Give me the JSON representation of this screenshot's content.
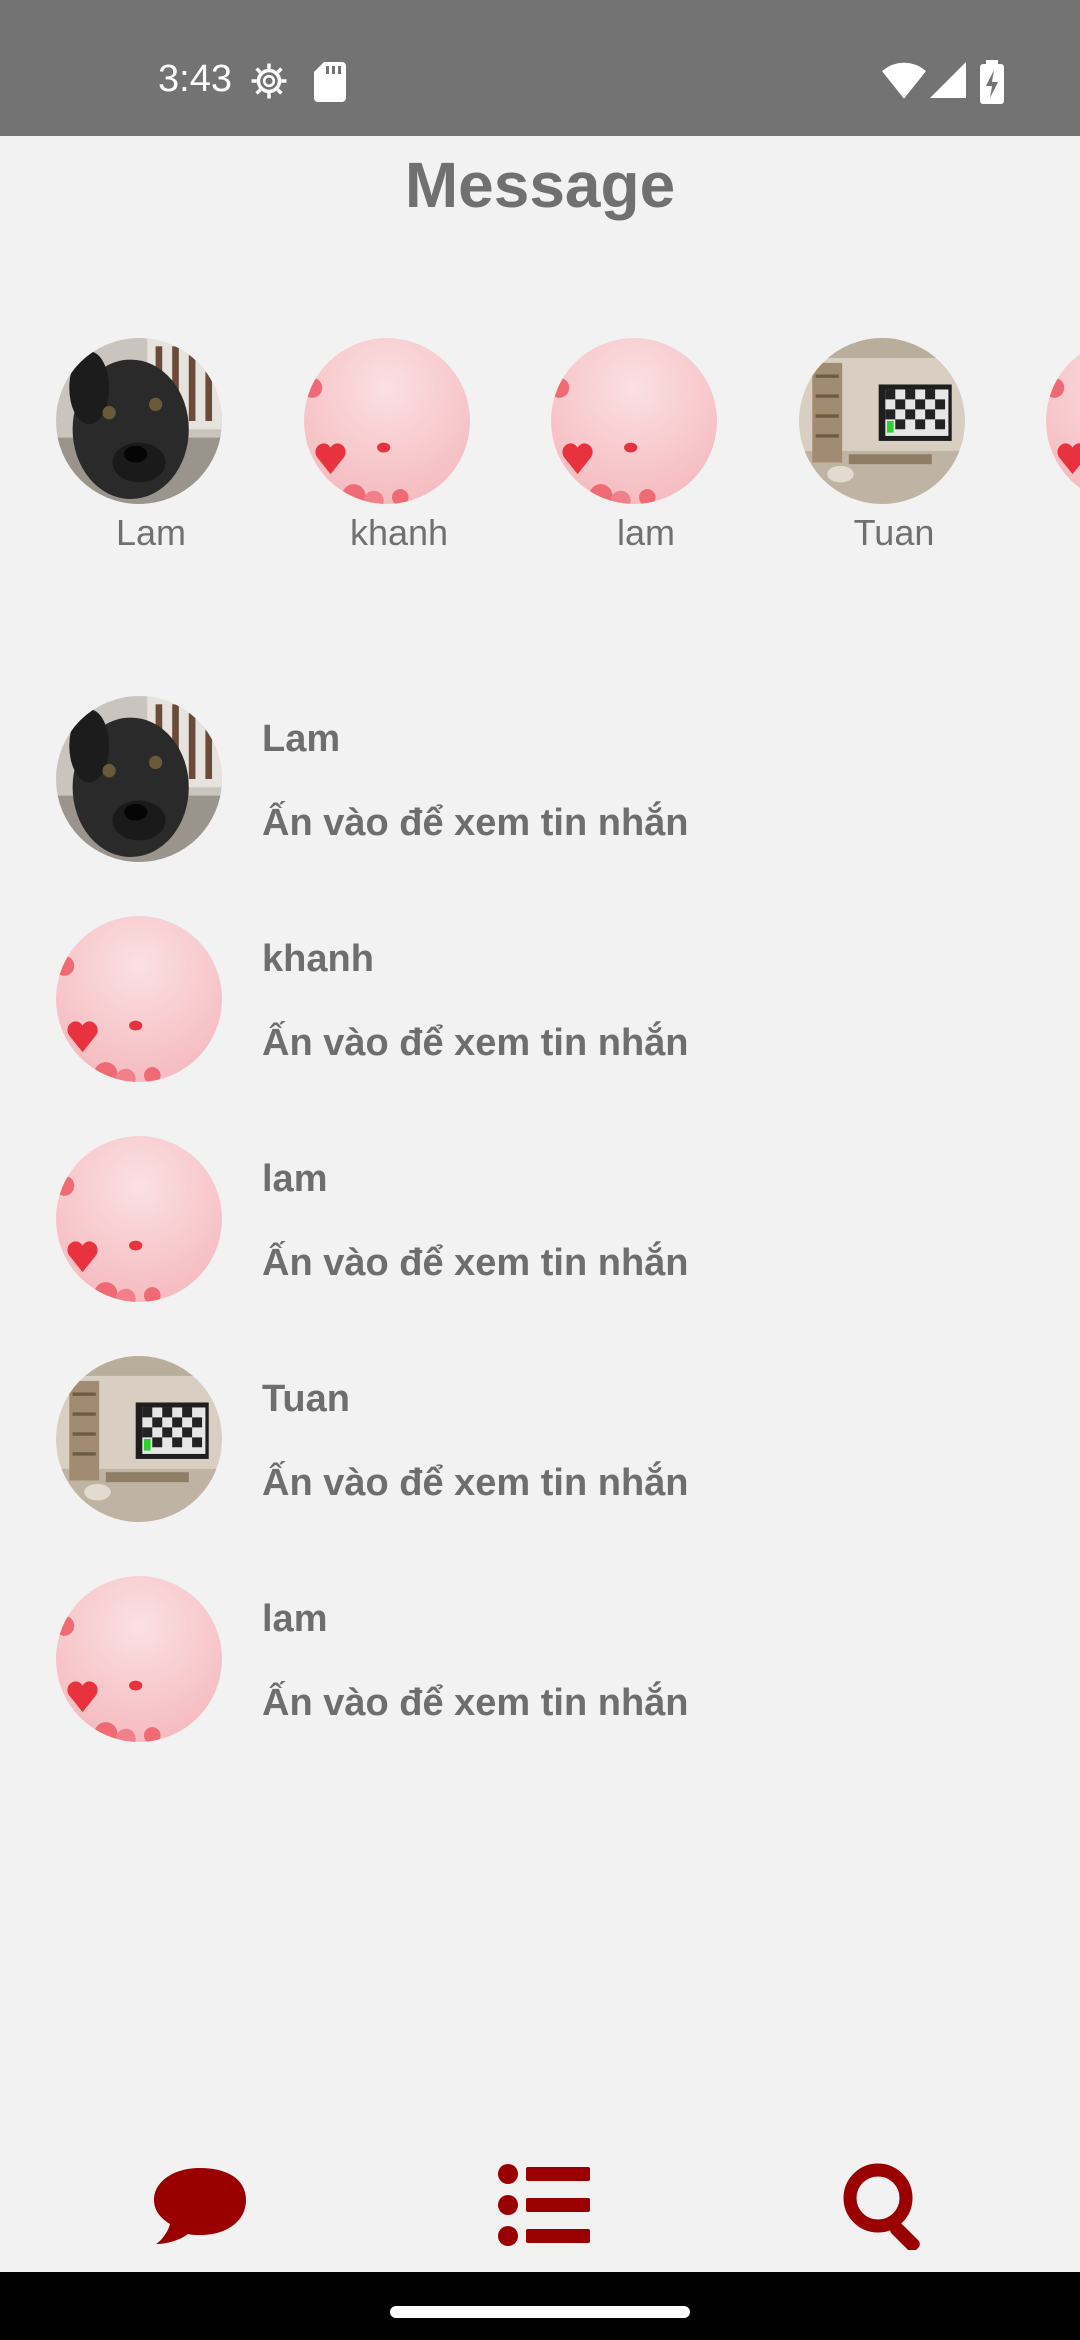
{
  "status_bar": {
    "time": "3:43",
    "icons": [
      "gear-icon",
      "sd-card-icon",
      "wifi-icon",
      "signal-icon",
      "battery-icon"
    ]
  },
  "header": {
    "title": "Message"
  },
  "stories": [
    {
      "name": "Lam",
      "avatar": "dog-photo"
    },
    {
      "name": "khanh",
      "avatar": "pink-hearts"
    },
    {
      "name": "lam",
      "avatar": "pink-hearts"
    },
    {
      "name": "Tuan",
      "avatar": "room-tv-photo"
    },
    {
      "name": "",
      "avatar": "pink-hearts"
    }
  ],
  "conversations": [
    {
      "name": "Lam",
      "preview": "Ấn vào để xem tin nhắn",
      "avatar": "dog-photo"
    },
    {
      "name": "khanh",
      "preview": "Ấn vào để xem tin nhắn",
      "avatar": "pink-hearts"
    },
    {
      "name": "lam",
      "preview": "Ấn vào để xem tin nhắn",
      "avatar": "pink-hearts"
    },
    {
      "name": "Tuan",
      "preview": "Ấn vào để xem tin nhắn",
      "avatar": "room-tv-photo"
    },
    {
      "name": "lam",
      "preview": "Ấn vào để xem tin nhắn",
      "avatar": "pink-hearts"
    }
  ],
  "bottom_nav": {
    "items": [
      {
        "icon": "chat-bubble-icon"
      },
      {
        "icon": "list-icon"
      },
      {
        "icon": "search-icon"
      }
    ],
    "accent_color": "#9b0000"
  },
  "colors": {
    "background": "#f2f2f2",
    "status_bar": "#737373",
    "text": "#6e6e6e"
  }
}
